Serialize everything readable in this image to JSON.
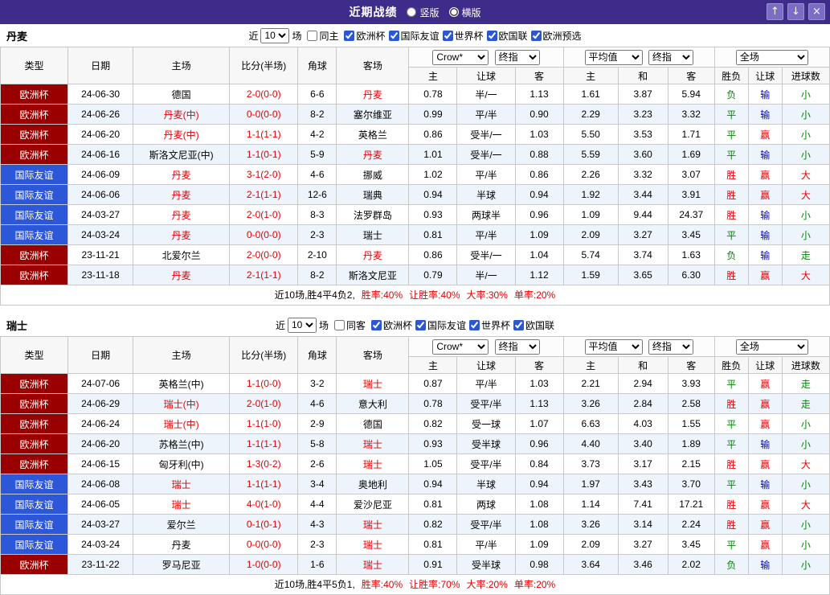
{
  "titlebar": {
    "title": "近期战绩",
    "layout_options": [
      {
        "label": "竖版",
        "selected": false
      },
      {
        "label": "横版",
        "selected": true
      }
    ],
    "buttons": {
      "up": "↑",
      "down": "↓",
      "close": "×"
    }
  },
  "table": {
    "col_headers": {
      "type": "类型",
      "date": "日期",
      "home": "主场",
      "score": "比分(半场)",
      "corner": "角球",
      "away": "客场",
      "sub": [
        "主",
        "让球",
        "客",
        "主",
        "和",
        "客",
        "胜负",
        "让球",
        "进球数"
      ]
    },
    "selects": {
      "bookmaker": "Crow*",
      "stage1": "终指",
      "average": "平均值",
      "stage2": "终指",
      "period": "全场"
    }
  },
  "colors": {
    "titlebar_bg": "#3f2b8a",
    "euro_bg": "#990000",
    "friendly_bg": "#2d57d9",
    "accent_red": "#e60000",
    "accent_green": "#008800",
    "accent_blue": "#0000cc"
  },
  "sections": [
    {
      "team": "丹麦",
      "filters": {
        "near": "近",
        "count": "10",
        "games": "场",
        "same": {
          "label": "同主",
          "checked": false
        },
        "leagues": [
          {
            "label": "欧洲杯",
            "checked": true
          },
          {
            "label": "国际友谊",
            "checked": true
          },
          {
            "label": "世界杯",
            "checked": true
          },
          {
            "label": "欧国联",
            "checked": true
          },
          {
            "label": "欧洲预选",
            "checked": true
          }
        ]
      },
      "rows": [
        {
          "type": "欧洲杯",
          "league": "euro",
          "date": "24-06-30",
          "home": "德国",
          "home_focal": false,
          "score": "2-0(0-0)",
          "corner": "6-6",
          "away": "丹麦",
          "away_focal": true,
          "odds": [
            "0.78",
            "半/一",
            "1.13",
            "1.61",
            "3.87",
            "5.94"
          ],
          "result": "负",
          "handicap": "输",
          "goals": "小"
        },
        {
          "type": "欧洲杯",
          "league": "euro",
          "date": "24-06-26",
          "home": "丹麦(中)",
          "home_focal": true,
          "score": "0-0(0-0)",
          "corner": "8-2",
          "away": "塞尔维亚",
          "away_focal": false,
          "odds": [
            "0.99",
            "平/半",
            "0.90",
            "2.29",
            "3.23",
            "3.32"
          ],
          "result": "平",
          "handicap": "输",
          "goals": "小"
        },
        {
          "type": "欧洲杯",
          "league": "euro",
          "date": "24-06-20",
          "home": "丹麦(中)",
          "home_focal": true,
          "score": "1-1(1-1)",
          "corner": "4-2",
          "away": "英格兰",
          "away_focal": false,
          "odds": [
            "0.86",
            "受半/一",
            "1.03",
            "5.50",
            "3.53",
            "1.71"
          ],
          "result": "平",
          "handicap": "赢",
          "goals": "小"
        },
        {
          "type": "欧洲杯",
          "league": "euro",
          "date": "24-06-16",
          "home": "斯洛文尼亚(中)",
          "home_focal": false,
          "score": "1-1(0-1)",
          "corner": "5-9",
          "away": "丹麦",
          "away_focal": true,
          "odds": [
            "1.01",
            "受半/一",
            "0.88",
            "5.59",
            "3.60",
            "1.69"
          ],
          "result": "平",
          "handicap": "输",
          "goals": "小"
        },
        {
          "type": "国际友谊",
          "league": "friendly",
          "date": "24-06-09",
          "home": "丹麦",
          "home_focal": true,
          "score": "3-1(2-0)",
          "corner": "4-6",
          "away": "挪威",
          "away_focal": false,
          "odds": [
            "1.02",
            "平/半",
            "0.86",
            "2.26",
            "3.32",
            "3.07"
          ],
          "result": "胜",
          "handicap": "赢",
          "goals": "大"
        },
        {
          "type": "国际友谊",
          "league": "friendly",
          "date": "24-06-06",
          "home": "丹麦",
          "home_focal": true,
          "score": "2-1(1-1)",
          "corner": "12-6",
          "away": "瑞典",
          "away_focal": false,
          "odds": [
            "0.94",
            "半球",
            "0.94",
            "1.92",
            "3.44",
            "3.91"
          ],
          "result": "胜",
          "handicap": "赢",
          "goals": "大"
        },
        {
          "type": "国际友谊",
          "league": "friendly",
          "date": "24-03-27",
          "home": "丹麦",
          "home_focal": true,
          "score": "2-0(1-0)",
          "corner": "8-3",
          "away": "法罗群岛",
          "away_focal": false,
          "odds": [
            "0.93",
            "两球半",
            "0.96",
            "1.09",
            "9.44",
            "24.37"
          ],
          "result": "胜",
          "handicap": "输",
          "goals": "小"
        },
        {
          "type": "国际友谊",
          "league": "friendly",
          "date": "24-03-24",
          "home": "丹麦",
          "home_focal": true,
          "score": "0-0(0-0)",
          "corner": "2-3",
          "away": "瑞士",
          "away_focal": false,
          "odds": [
            "0.81",
            "平/半",
            "1.09",
            "2.09",
            "3.27",
            "3.45"
          ],
          "result": "平",
          "handicap": "输",
          "goals": "小"
        },
        {
          "type": "欧洲杯",
          "league": "euro",
          "date": "23-11-21",
          "home": "北爱尔兰",
          "home_focal": false,
          "score": "2-0(0-0)",
          "corner": "2-10",
          "away": "丹麦",
          "away_focal": true,
          "odds": [
            "0.86",
            "受半/一",
            "1.04",
            "5.74",
            "3.74",
            "1.63"
          ],
          "result": "负",
          "handicap": "输",
          "goals": "走"
        },
        {
          "type": "欧洲杯",
          "league": "euro",
          "date": "23-11-18",
          "home": "丹麦",
          "home_focal": true,
          "score": "2-1(1-1)",
          "corner": "8-2",
          "away": "斯洛文尼亚",
          "away_focal": false,
          "odds": [
            "0.79",
            "半/一",
            "1.12",
            "1.59",
            "3.65",
            "6.30"
          ],
          "result": "胜",
          "handicap": "赢",
          "goals": "大"
        }
      ],
      "summary": {
        "prefix": "近10场,胜4平4负2,",
        "stats": [
          "胜率:40%",
          "让胜率:40%",
          "大率:30%",
          "单率:20%"
        ]
      }
    },
    {
      "team": "瑞士",
      "filters": {
        "near": "近",
        "count": "10",
        "games": "场",
        "same": {
          "label": "同客",
          "checked": false
        },
        "leagues": [
          {
            "label": "欧洲杯",
            "checked": true
          },
          {
            "label": "国际友谊",
            "checked": true
          },
          {
            "label": "世界杯",
            "checked": true
          },
          {
            "label": "欧国联",
            "checked": true
          }
        ]
      },
      "rows": [
        {
          "type": "欧洲杯",
          "league": "euro",
          "date": "24-07-06",
          "home": "英格兰(中)",
          "home_focal": false,
          "score": "1-1(0-0)",
          "corner": "3-2",
          "away": "瑞士",
          "away_focal": true,
          "odds": [
            "0.87",
            "平/半",
            "1.03",
            "2.21",
            "2.94",
            "3.93"
          ],
          "result": "平",
          "handicap": "赢",
          "goals": "走"
        },
        {
          "type": "欧洲杯",
          "league": "euro",
          "date": "24-06-29",
          "home": "瑞士(中)",
          "home_focal": true,
          "score": "2-0(1-0)",
          "corner": "4-6",
          "away": "意大利",
          "away_focal": false,
          "odds": [
            "0.78",
            "受平/半",
            "1.13",
            "3.26",
            "2.84",
            "2.58"
          ],
          "result": "胜",
          "handicap": "赢",
          "goals": "走"
        },
        {
          "type": "欧洲杯",
          "league": "euro",
          "date": "24-06-24",
          "home": "瑞士(中)",
          "home_focal": true,
          "score": "1-1(1-0)",
          "corner": "2-9",
          "away": "德国",
          "away_focal": false,
          "odds": [
            "0.82",
            "受一球",
            "1.07",
            "6.63",
            "4.03",
            "1.55"
          ],
          "result": "平",
          "handicap": "赢",
          "goals": "小"
        },
        {
          "type": "欧洲杯",
          "league": "euro",
          "date": "24-06-20",
          "home": "苏格兰(中)",
          "home_focal": false,
          "score": "1-1(1-1)",
          "corner": "5-8",
          "away": "瑞士",
          "away_focal": true,
          "odds": [
            "0.93",
            "受半球",
            "0.96",
            "4.40",
            "3.40",
            "1.89"
          ],
          "result": "平",
          "handicap": "输",
          "goals": "小"
        },
        {
          "type": "欧洲杯",
          "league": "euro",
          "date": "24-06-15",
          "home": "匈牙利(中)",
          "home_focal": false,
          "score": "1-3(0-2)",
          "corner": "2-6",
          "away": "瑞士",
          "away_focal": true,
          "odds": [
            "1.05",
            "受平/半",
            "0.84",
            "3.73",
            "3.17",
            "2.15"
          ],
          "result": "胜",
          "handicap": "赢",
          "goals": "大"
        },
        {
          "type": "国际友谊",
          "league": "friendly",
          "date": "24-06-08",
          "home": "瑞士",
          "home_focal": true,
          "score": "1-1(1-1)",
          "corner": "3-4",
          "away": "奥地利",
          "away_focal": false,
          "odds": [
            "0.94",
            "半球",
            "0.94",
            "1.97",
            "3.43",
            "3.70"
          ],
          "result": "平",
          "handicap": "输",
          "goals": "小"
        },
        {
          "type": "国际友谊",
          "league": "friendly",
          "date": "24-06-05",
          "home": "瑞士",
          "home_focal": true,
          "score": "4-0(1-0)",
          "corner": "4-4",
          "away": "爱沙尼亚",
          "away_focal": false,
          "odds": [
            "0.81",
            "两球",
            "1.08",
            "1.14",
            "7.41",
            "17.21"
          ],
          "result": "胜",
          "handicap": "赢",
          "goals": "大"
        },
        {
          "type": "国际友谊",
          "league": "friendly",
          "date": "24-03-27",
          "home": "爱尔兰",
          "home_focal": false,
          "score": "0-1(0-1)",
          "corner": "4-3",
          "away": "瑞士",
          "away_focal": true,
          "odds": [
            "0.82",
            "受平/半",
            "1.08",
            "3.26",
            "3.14",
            "2.24"
          ],
          "result": "胜",
          "handicap": "赢",
          "goals": "小"
        },
        {
          "type": "国际友谊",
          "league": "friendly",
          "date": "24-03-24",
          "home": "丹麦",
          "home_focal": false,
          "score": "0-0(0-0)",
          "corner": "2-3",
          "away": "瑞士",
          "away_focal": true,
          "odds": [
            "0.81",
            "平/半",
            "1.09",
            "2.09",
            "3.27",
            "3.45"
          ],
          "result": "平",
          "handicap": "赢",
          "goals": "小"
        },
        {
          "type": "欧洲杯",
          "league": "euro",
          "date": "23-11-22",
          "home": "罗马尼亚",
          "home_focal": false,
          "score": "1-0(0-0)",
          "corner": "1-6",
          "away": "瑞士",
          "away_focal": true,
          "odds": [
            "0.91",
            "受半球",
            "0.98",
            "3.64",
            "3.46",
            "2.02"
          ],
          "result": "负",
          "handicap": "输",
          "goals": "小"
        }
      ],
      "summary": {
        "prefix": "近10场,胜4平5负1,",
        "stats": [
          "胜率:40%",
          "让胜率:70%",
          "大率:20%",
          "单率:20%"
        ]
      }
    }
  ]
}
